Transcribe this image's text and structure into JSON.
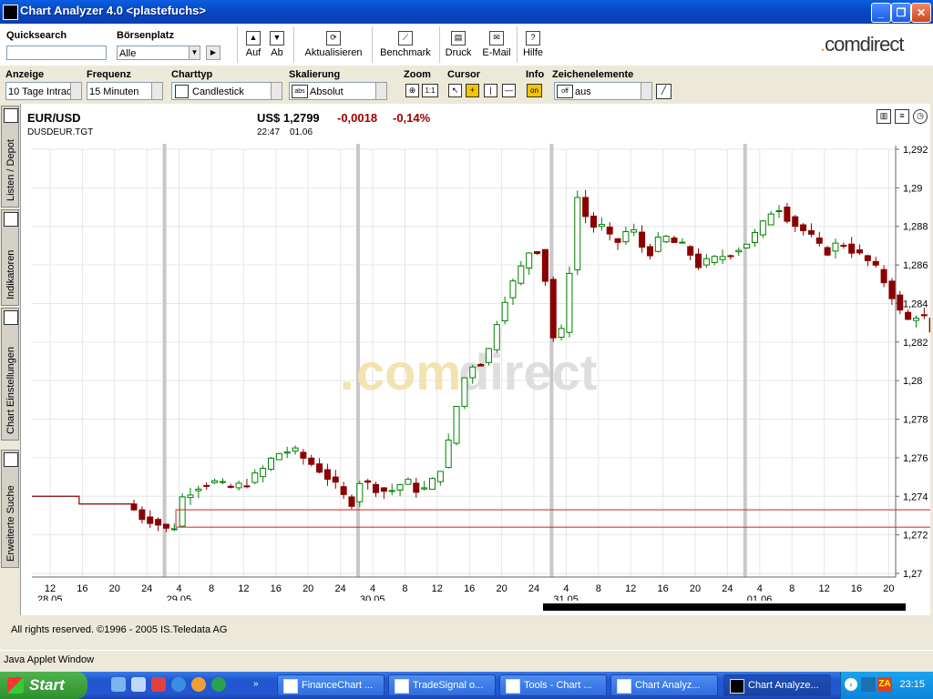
{
  "window": {
    "title": "Chart Analyzer 4.0  <plastefuchs>",
    "min": "_",
    "max": "❐",
    "close": "✕"
  },
  "toolbar": {
    "quicksearch_label": "Quicksearch",
    "quicksearch_value": "",
    "exchange_label": "Börsenplatz",
    "exchange_value": "Alle",
    "go": "▶",
    "up_label": "Auf",
    "down_label": "Ab",
    "refresh_label": "Aktualisieren",
    "benchmark_label": "Benchmark",
    "print_label": "Druck",
    "email_label": "E-Mail",
    "help_label": "Hilfe",
    "brand_dot": ".",
    "brand_text": "comdirect"
  },
  "controls": {
    "anzeige_label": "Anzeige",
    "anzeige_value": "10 Tage Intraday",
    "frequenz_label": "Frequenz",
    "frequenz_value": "15 Minuten",
    "charttyp_label": "Charttyp",
    "charttyp_value": "Candlestick",
    "skalierung_label": "Skalierung",
    "skalierung_value": "Absolut",
    "skalierung_icon": "abs",
    "zoom_label": "Zoom",
    "zoom_one": "1:1",
    "cursor_label": "Cursor",
    "info_label": "Info",
    "info_value": "on",
    "zeichen_label": "Zeichenelemente",
    "zeichen_toggle": "off",
    "zeichen_value": "aus"
  },
  "sidebar": {
    "tabs": [
      {
        "label": "Listen / Depot"
      },
      {
        "label": "Indikatoren"
      },
      {
        "label": "Chart Einstellungen"
      },
      {
        "label": "Erweiterte Suche"
      }
    ]
  },
  "quote": {
    "symbol": "EUR/USD",
    "code": "DUSDEUR.TGT",
    "price": "US$ 1,2799",
    "change": "-0,0018",
    "change_pct": "-0,14%",
    "time": "22:47",
    "date": "01.06"
  },
  "watermark": {
    "dot": ".",
    "com": "com",
    "direct": "direct"
  },
  "chart_data": {
    "type": "candlestick",
    "y_ticks": [
      "1,292",
      "1,29",
      "1,288",
      "1,286",
      "1,284",
      "1,282",
      "1,28",
      "1,278",
      "1,276",
      "1,274",
      "1,272",
      "1,27"
    ],
    "ylim": [
      1.27,
      1.292
    ],
    "x_hour_ticks": [
      "12",
      "16",
      "20",
      "24",
      "4",
      "8",
      "12",
      "16",
      "20",
      "24",
      "4",
      "8",
      "12",
      "16",
      "20",
      "24",
      "4",
      "8",
      "12",
      "16",
      "20",
      "24",
      "4",
      "8",
      "12",
      "16",
      "20"
    ],
    "x_date_labels": [
      {
        "label": "28.05",
        "hour_index": 0
      },
      {
        "label": "29.05",
        "hour_index": 4
      },
      {
        "label": "30.05",
        "hour_index": 10
      },
      {
        "label": "31.05",
        "hour_index": 16
      },
      {
        "label": "01.06",
        "hour_index": 22
      }
    ],
    "up_color": "#008000",
    "down_color": "#8b0000",
    "highlight_box": {
      "y_low": 1.2724,
      "y_high": 1.2733
    },
    "close_path": [
      [
        0,
        1.274
      ],
      [
        0.5,
        1.274
      ],
      [
        1.0,
        1.2736
      ],
      [
        2.5,
        1.2736
      ],
      [
        2.7,
        1.273
      ],
      [
        3.1,
        1.2728
      ],
      [
        3.5,
        1.2724
      ],
      [
        3.8,
        1.272
      ],
      [
        4.0,
        1.2738
      ],
      [
        4.5,
        1.2745
      ],
      [
        5.0,
        1.2748
      ],
      [
        5.5,
        1.2744
      ],
      [
        6.0,
        1.2746
      ],
      [
        6.5,
        1.2752
      ],
      [
        7.0,
        1.2762
      ],
      [
        7.5,
        1.2764
      ],
      [
        8.0,
        1.2758
      ],
      [
        8.5,
        1.2752
      ],
      [
        9.0,
        1.2742
      ],
      [
        9.3,
        1.2735
      ],
      [
        9.6,
        1.2748
      ],
      [
        10.0,
        1.2745
      ],
      [
        10.5,
        1.2742
      ],
      [
        11.0,
        1.2748
      ],
      [
        11.5,
        1.2742
      ],
      [
        12.0,
        1.275
      ],
      [
        12.4,
        1.277
      ],
      [
        12.7,
        1.2795
      ],
      [
        13.0,
        1.2808
      ],
      [
        13.5,
        1.281
      ],
      [
        14.0,
        1.284
      ],
      [
        14.5,
        1.2855
      ],
      [
        15.0,
        1.2872
      ],
      [
        15.3,
        1.286
      ],
      [
        15.5,
        1.283
      ],
      [
        15.7,
        1.2815
      ],
      [
        16.0,
        1.2835
      ],
      [
        16.2,
        1.288
      ],
      [
        16.4,
        1.29
      ],
      [
        16.7,
        1.2878
      ],
      [
        17.0,
        1.2882
      ],
      [
        17.5,
        1.287
      ],
      [
        18.0,
        1.288
      ],
      [
        18.5,
        1.2865
      ],
      [
        19.0,
        1.2875
      ],
      [
        19.5,
        1.287
      ],
      [
        19.7,
        1.2869
      ],
      [
        20.1,
        1.286
      ],
      [
        20.5,
        1.2862
      ],
      [
        21.0,
        1.2866
      ],
      [
        21.5,
        1.287
      ],
      [
        22.0,
        1.2878
      ],
      [
        22.5,
        1.2892
      ],
      [
        23.0,
        1.2882
      ],
      [
        23.5,
        1.2876
      ],
      [
        24.0,
        1.2866
      ],
      [
        24.5,
        1.2872
      ],
      [
        25.0,
        1.2866
      ],
      [
        25.5,
        1.286
      ],
      [
        26.0,
        1.2848
      ],
      [
        26.5,
        1.283
      ],
      [
        27.0,
        1.2836
      ],
      [
        27.5,
        1.2818
      ],
      [
        28.0,
        1.281
      ],
      [
        28.5,
        1.2816
      ],
      [
        29.0,
        1.2814
      ],
      [
        29.5,
        1.281
      ],
      [
        30.0,
        1.279
      ],
      [
        30.5,
        1.2776
      ],
      [
        31.0,
        1.2766
      ],
      [
        31.5,
        1.2772
      ],
      [
        32.0,
        1.277
      ],
      [
        32.5,
        1.276
      ],
      [
        33.0,
        1.2782
      ],
      [
        33.3,
        1.2778
      ],
      [
        33.6,
        1.2765
      ],
      [
        34.0,
        1.2745
      ],
      [
        34.4,
        1.273
      ],
      [
        34.7,
        1.2735
      ],
      [
        35.0,
        1.276
      ],
      [
        35.3,
        1.28
      ],
      [
        35.6,
        1.2818
      ],
      [
        36.0,
        1.2812
      ],
      [
        36.5,
        1.2805
      ],
      [
        36.9,
        1.2798
      ]
    ]
  },
  "footer": {
    "copyright": "All rights reserved. ©1996 - 2005 IS.Teledata AG",
    "applet": "Java Applet Window"
  },
  "taskbar": {
    "start": "Start",
    "tasks": [
      {
        "label": "FinanceChart ..."
      },
      {
        "label": "TradeSignal o..."
      },
      {
        "label": "Tools - Chart ..."
      },
      {
        "label": "Chart Analyz..."
      },
      {
        "label": "Chart Analyze..."
      }
    ],
    "clock": "23:15"
  }
}
